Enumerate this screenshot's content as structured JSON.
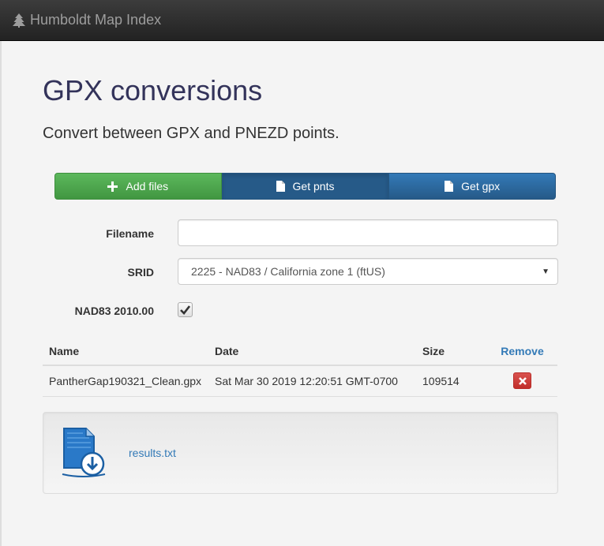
{
  "navbar": {
    "brand": "Humboldt Map Index",
    "brand_icon": "tree-icon"
  },
  "page": {
    "title": "GPX conversions",
    "lead": "Convert between GPX and PNEZD points."
  },
  "toolbar": {
    "add_files": "Add files",
    "get_pnts": "Get pnts",
    "get_gpx": "Get gpx"
  },
  "form": {
    "filename_label": "Filename",
    "filename_value": "",
    "srid_label": "SRID",
    "srid_value": "2225 - NAD83 / California zone 1 (ftUS)",
    "nad83_label": "NAD83 2010.00",
    "nad83_checked": true
  },
  "table": {
    "columns": [
      "Name",
      "Date",
      "Size",
      "Remove"
    ],
    "rows": [
      {
        "name": "PantherGap190321_Clean.gpx",
        "date": "Sat Mar 30 2019 12:20:51 GMT-0700",
        "size": "109514"
      }
    ]
  },
  "results": {
    "file_name": "results.txt",
    "icon": "file-download-icon"
  },
  "colors": {
    "success": "#5cb85c",
    "primary": "#337ab7",
    "danger": "#d9534f",
    "title": "#33335a"
  }
}
